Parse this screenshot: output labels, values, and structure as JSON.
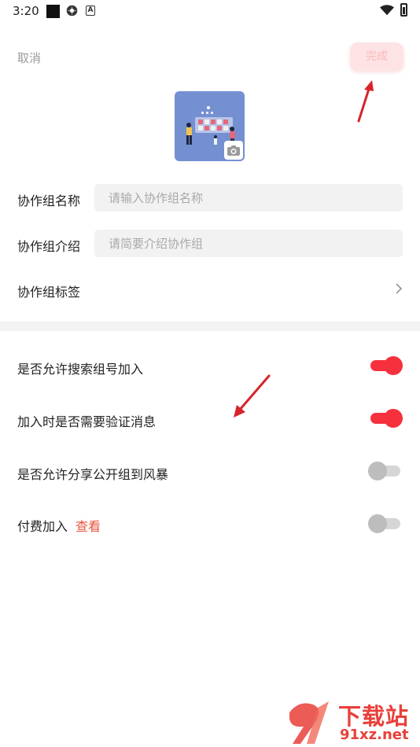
{
  "status_bar": {
    "time": "3:20",
    "icons": [
      "notification-square-icon",
      "gear-icon",
      "a-badge-icon",
      "wifi-icon",
      "battery-icon"
    ]
  },
  "header": {
    "cancel_label": "取消",
    "done_label": "完成"
  },
  "cover": {
    "icon": "camera-icon"
  },
  "form": {
    "name_label": "协作组名称",
    "name_placeholder": "请输入协作组名称",
    "name_value": "",
    "intro_label": "协作组介绍",
    "intro_placeholder": "请简要介绍协作组",
    "intro_value": "",
    "tags_label": "协作组标签"
  },
  "settings": {
    "items": [
      {
        "label": "是否允许搜索组号加入",
        "enabled": true
      },
      {
        "label": "加入时是否需要验证消息",
        "enabled": true
      },
      {
        "label": "是否允许分享公开组到风暴",
        "enabled": false
      },
      {
        "label": "付费加入",
        "link": "查看",
        "enabled": false
      }
    ]
  },
  "watermark": {
    "title": "下载站",
    "url": "91xz.net"
  },
  "colors": {
    "accent": "#f6303d",
    "link": "#e8523b",
    "done_bg": "#fde3e4",
    "cover_bg": "#7490d1"
  }
}
